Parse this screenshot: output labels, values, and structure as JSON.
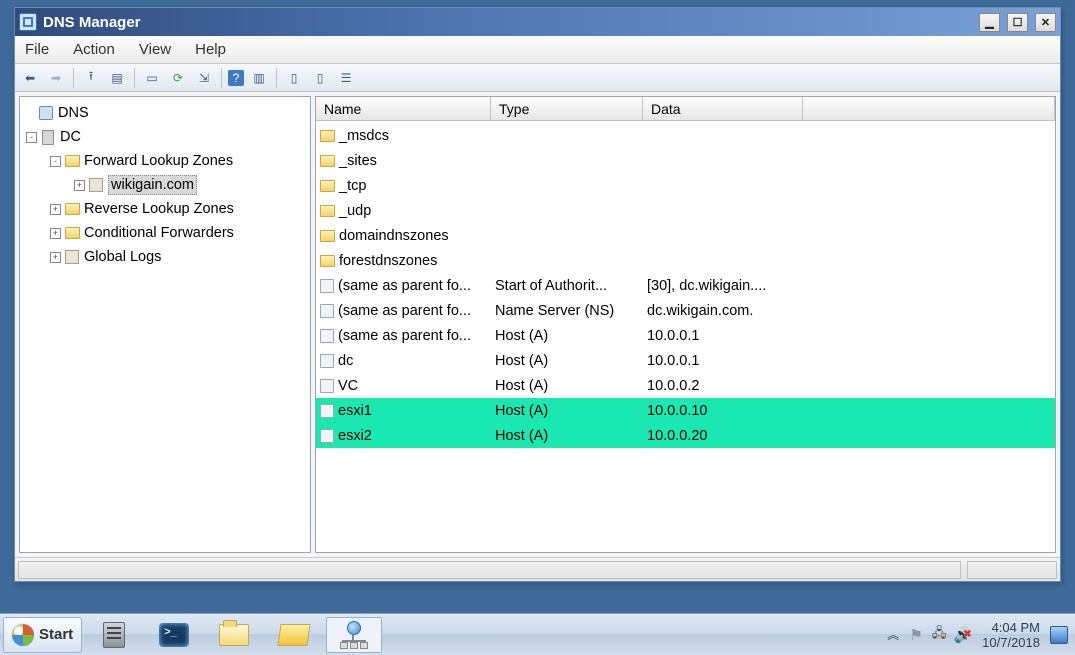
{
  "window": {
    "title": "DNS Manager"
  },
  "menubar": [
    "File",
    "Action",
    "View",
    "Help"
  ],
  "toolbar_icons": [
    "back",
    "forward",
    "up",
    "show-hide-tree",
    "delete",
    "refresh",
    "export-list",
    "help",
    "properties",
    "new-record",
    "stop",
    "filter"
  ],
  "tree": {
    "root": {
      "label": "DNS"
    },
    "server": {
      "label": "DC"
    },
    "forward": {
      "label": "Forward Lookup Zones"
    },
    "zone": {
      "label": "wikigain.com"
    },
    "reverse": {
      "label": "Reverse Lookup Zones"
    },
    "cond": {
      "label": "Conditional Forwarders"
    },
    "logs": {
      "label": "Global Logs"
    }
  },
  "columns": {
    "name": "Name",
    "type": "Type",
    "data": "Data"
  },
  "records": [
    {
      "icon": "folder",
      "name": "_msdcs",
      "type": "",
      "data": "",
      "hl": false
    },
    {
      "icon": "folder",
      "name": "_sites",
      "type": "",
      "data": "",
      "hl": false
    },
    {
      "icon": "folder",
      "name": "_tcp",
      "type": "",
      "data": "",
      "hl": false
    },
    {
      "icon": "folder",
      "name": "_udp",
      "type": "",
      "data": "",
      "hl": false
    },
    {
      "icon": "folder",
      "name": "domaindnszones",
      "type": "",
      "data": "",
      "hl": false
    },
    {
      "icon": "folder",
      "name": "forestdnszones",
      "type": "",
      "data": "",
      "hl": false
    },
    {
      "icon": "rec",
      "name": "(same as parent fo...",
      "type": "Start of Authorit...",
      "data": "[30], dc.wikigain....",
      "hl": false
    },
    {
      "icon": "rec",
      "name": "(same as parent fo...",
      "type": "Name Server (NS)",
      "data": "dc.wikigain.com.",
      "hl": false
    },
    {
      "icon": "rec",
      "name": "(same as parent fo...",
      "type": "Host (A)",
      "data": "10.0.0.1",
      "hl": false
    },
    {
      "icon": "rec",
      "name": "dc",
      "type": "Host (A)",
      "data": "10.0.0.1",
      "hl": false
    },
    {
      "icon": "rec",
      "name": "VC",
      "type": "Host (A)",
      "data": "10.0.0.2",
      "hl": false
    },
    {
      "icon": "rec",
      "name": "esxi1",
      "type": "Host (A)",
      "data": "10.0.0.10",
      "hl": true
    },
    {
      "icon": "rec",
      "name": "esxi2",
      "type": "Host (A)",
      "data": "10.0.0.20",
      "hl": true
    }
  ],
  "taskbar": {
    "start": "Start",
    "time": "4:04 PM",
    "date": "10/7/2018"
  }
}
